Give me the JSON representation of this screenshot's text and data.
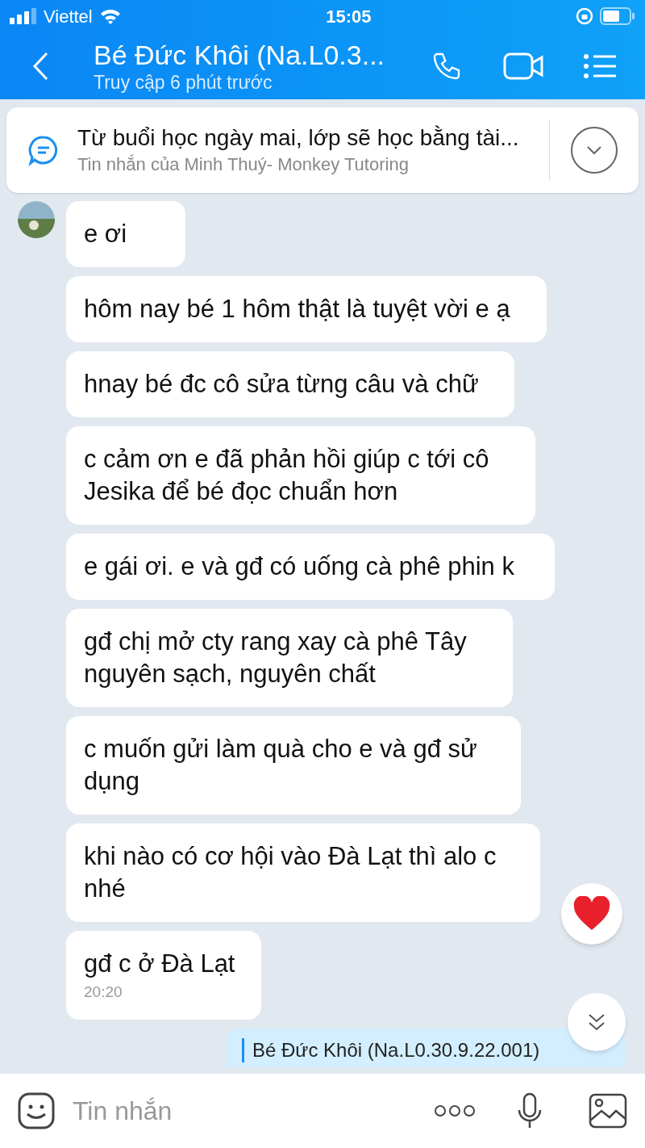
{
  "status_bar": {
    "carrier": "Viettel",
    "time": "15:05"
  },
  "header": {
    "title": "Bé Đức Khôi (Na.L0.3...",
    "subtitle": "Truy cập 6 phút trước"
  },
  "pinned": {
    "text": "Từ buổi học ngày mai, lớp sẽ học bằng tài...",
    "source": "Tin nhắn của Minh Thuý- Monkey Tutoring"
  },
  "messages": [
    {
      "text": "e ơi",
      "avatar": true
    },
    {
      "text": "hôm nay bé 1 hôm thật là tuyệt vời e ạ"
    },
    {
      "text": "hnay bé đc cô sửa từng câu và chữ"
    },
    {
      "text": "c cảm ơn e đã phản hồi giúp c tới cô Jesika để bé đọc chuẩn hơn"
    },
    {
      "text": "e gái ơi. e và gđ có uống cà phê phin k"
    },
    {
      "text": "gđ chị mở cty rang xay cà phê Tây nguyên sạch, nguyên chất"
    },
    {
      "text": "c muốn gửi làm quà cho e và gđ sử dụng"
    },
    {
      "text": "khi nào có cơ hội vào Đà Lạt thì alo c nhé",
      "reaction": true
    },
    {
      "text": "gđ c ở Đà Lạt",
      "time": "20:20"
    }
  ],
  "sent_quote": "Bé Đức Khôi (Na.L0.30.9.22.001)",
  "composer": {
    "placeholder": "Tin nhắn"
  }
}
